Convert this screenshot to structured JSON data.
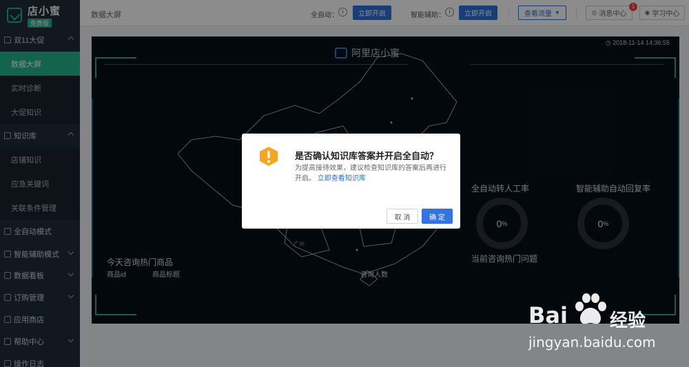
{
  "app": {
    "logo_title": "店小蜜",
    "logo_badge": "免费版"
  },
  "sidebar": {
    "groups": [
      {
        "label": "双11大促",
        "items": [
          "数据大屏",
          "实时诊断",
          "大促知识"
        ]
      },
      {
        "label": "知识库",
        "items": [
          "店铺知识",
          "应急关键词",
          "关联条件管理"
        ]
      },
      {
        "label": "全自动模式"
      },
      {
        "label": "智能辅助模式"
      },
      {
        "label": "数据看板"
      },
      {
        "label": "订购管理"
      },
      {
        "label": "应用商店"
      },
      {
        "label": "帮助中心"
      },
      {
        "label": "操作日志"
      }
    ],
    "active_item": "数据大屏"
  },
  "topbar": {
    "breadcrumb": "数据大屏",
    "auto_label": "全自动：",
    "auto_button": "立即开启",
    "assist_label": "智能辅助：",
    "assist_button": "立即开启",
    "traffic_button": "查看流量",
    "message_center": "消息中心",
    "message_count": "1",
    "learning_center": "学习中心"
  },
  "dashboard": {
    "title": "阿里店小蜜",
    "timestamp": "2018-11-14 14:36:55",
    "hot_products_title": "今天咨询热门商品",
    "hot_products_columns": [
      "商品id",
      "商品标题",
      "咨询人数"
    ],
    "hot_questions_title": "当前咨询热门问题",
    "metrics": [
      {
        "label": "全自动转人工率",
        "value": "0",
        "unit": "%"
      },
      {
        "label": "智能辅助自动回复率",
        "value": "0",
        "unit": "%"
      }
    ],
    "map_labels": [
      "广州"
    ]
  },
  "modal": {
    "title": "是否确认知识库答案并开启全自动？",
    "body": "为提高接待效果，建议检查知识库的答案后再进行开启。",
    "link": "立即查看知识库",
    "cancel": "取 消",
    "confirm": "确 定"
  },
  "watermark": {
    "brand": "Bai",
    "brand_cn": "经验",
    "url": "jingyan.baidu.com"
  },
  "colors": {
    "sidebar_bg": "#1f2d3a",
    "accent_green": "#23b58c",
    "primary_blue": "#2b71d9",
    "dashboard_bg": "#071017",
    "frame_teal": "#2fa7a1"
  }
}
